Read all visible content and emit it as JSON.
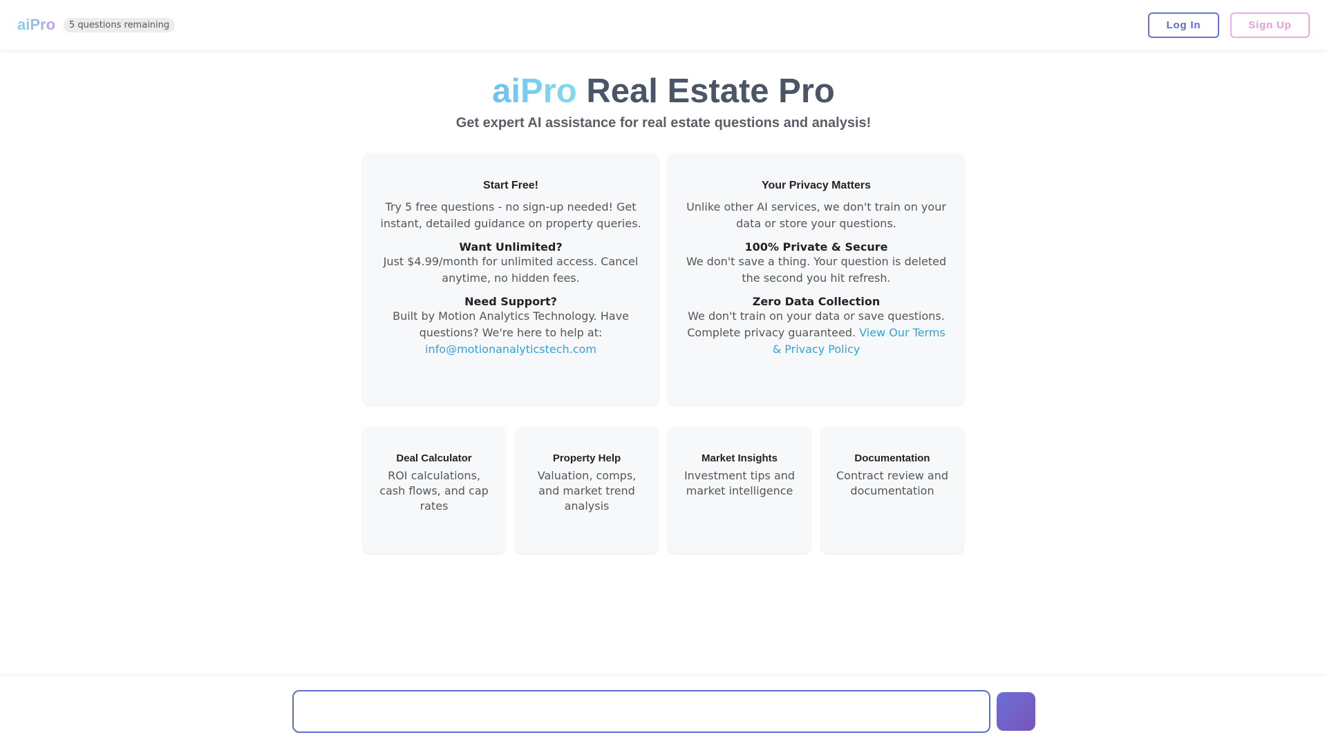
{
  "header": {
    "logo": "aiPro",
    "questions_badge": "5 questions remaining",
    "login_label": "Log In",
    "signup_label": "Sign Up"
  },
  "hero": {
    "brand": "aiPro",
    "title_rest": " Real Estate Pro",
    "subtitle": "Get expert AI assistance for real estate questions and analysis!"
  },
  "info_cards": {
    "left": {
      "icon": "gift-icon",
      "glyph": "",
      "heading": "Start Free!",
      "intro": "Try 5 free questions - no sign-up needed! Get instant, detailed guidance on property queries.",
      "unlimited_title": "Want Unlimited?",
      "unlimited_text": "Just $4.99/month for unlimited access. Cancel anytime, no hidden fees.",
      "support_title": "Need Support?",
      "support_text": "Built by Motion Analytics Technology. Have questions? We're here to help at:",
      "support_email": "info@motionanalyticstech.com"
    },
    "right": {
      "icon": "shield-icon",
      "glyph": "",
      "heading": "Your Privacy Matters",
      "intro": "Unlike other AI services, we don't train on your data or store your questions.",
      "secure_title": "100% Private & Secure",
      "secure_text": "We don't save a thing. Your question is deleted the second you hit refresh.",
      "zero_title": "Zero Data Collection",
      "zero_text": "We don't train on your data or save questions. Complete privacy guaranteed. ",
      "terms_link": "View Our Terms & Privacy Policy"
    }
  },
  "features": [
    {
      "icon": "calculator-icon",
      "glyph": "",
      "title": "Deal Calculator",
      "text": "ROI calculations, cash flows, and cap rates"
    },
    {
      "icon": "home-icon",
      "glyph": "",
      "title": "Property Help",
      "text": "Valuation, comps, and market trend analysis"
    },
    {
      "icon": "chart-icon",
      "glyph": "",
      "title": "Market Insights",
      "text": "Investment tips and market intelligence"
    },
    {
      "icon": "document-icon",
      "glyph": "",
      "title": "Documentation",
      "text": "Contract review and documentation"
    }
  ],
  "chat": {
    "input_value": "",
    "input_placeholder": "",
    "send_icon": "send-icon",
    "send_glyph": ""
  },
  "colors": {
    "accent_blue": "#5b6bd6",
    "accent_pink": "#f0a8e2",
    "link": "#2fa3dd",
    "icon": "#6878d8"
  }
}
